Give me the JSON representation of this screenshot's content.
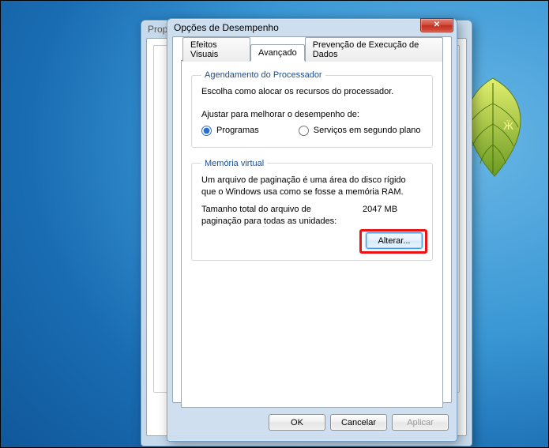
{
  "desktop": {
    "leaf_color_top": "#d7e24a",
    "leaf_color_bottom": "#7aa72a"
  },
  "back_window": {
    "title_fragment": "Prop"
  },
  "dialog": {
    "title": "Opções de Desempenho",
    "close_glyph": "✕",
    "tabs": {
      "visual": "Efeitos Visuais",
      "advanced": "Avançado",
      "dep": "Prevenção de Execução de Dados"
    },
    "scheduling": {
      "legend": "Agendamento do Processador",
      "desc": "Escolha como alocar os recursos do processador.",
      "adjust_label": "Ajustar para melhorar o desempenho de:",
      "option_programs": "Programas",
      "option_background": "Serviços em segundo plano",
      "selected": "programs"
    },
    "vm": {
      "legend": "Memória virtual",
      "desc": "Um arquivo de paginação é uma área do disco rígido que o Windows usa como se fosse a memória RAM.",
      "total_label": "Tamanho total do arquivo de paginação para todas as unidades:",
      "total_value": "2047 MB",
      "change_btn": "Alterar..."
    },
    "footer": {
      "ok": "OK",
      "cancel": "Cancelar",
      "apply": "Aplicar"
    }
  }
}
